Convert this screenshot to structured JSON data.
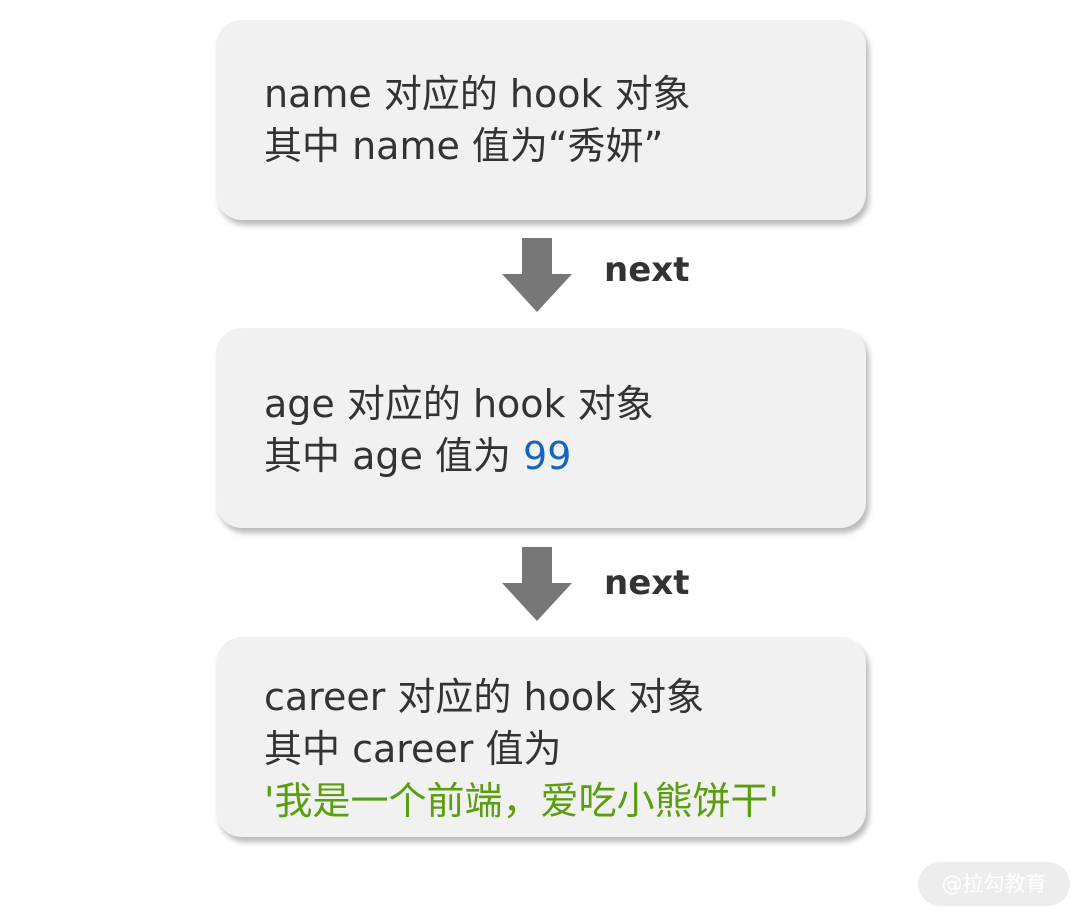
{
  "nodes": [
    {
      "line1": "name 对应的 hook 对象",
      "line2_prefix": "其中 name 值为",
      "line2_value": "“秀妍”"
    },
    {
      "line1": "age 对应的 hook 对象",
      "line2_prefix": "其中 age 值为 ",
      "line2_value": "99"
    },
    {
      "line1": "career 对应的 hook 对象",
      "line2": "其中 career 值为",
      "line3": "'我是一个前端，爱吃小熊饼干'"
    }
  ],
  "edges": [
    {
      "label": "next"
    },
    {
      "label": "next"
    }
  ],
  "watermark": "@拉勾教育",
  "colors": {
    "node_fill": "#f1f1f1",
    "text": "#333333",
    "arrow": "#777777",
    "number_value": "#1565c0",
    "string_value": "#5a9e0f"
  }
}
